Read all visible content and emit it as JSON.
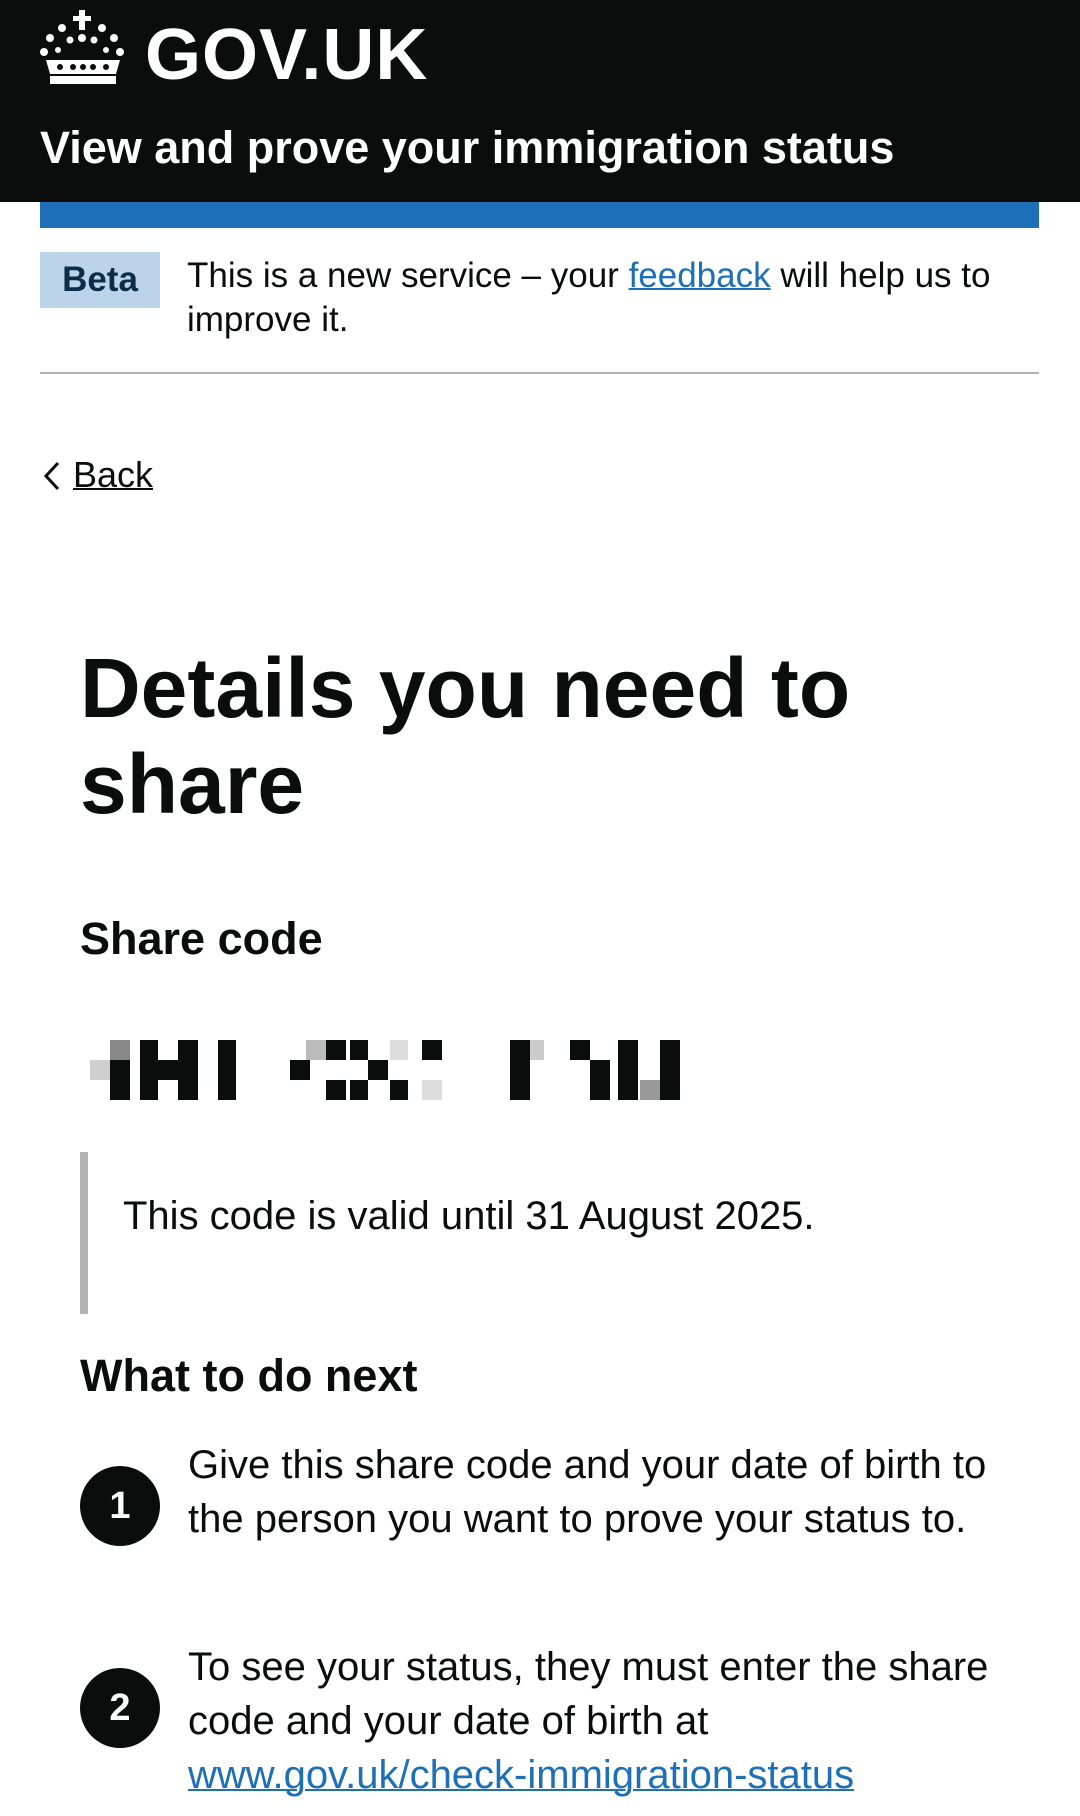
{
  "header": {
    "logo_text": "GOV.UK",
    "service_name": "View and prove your immigration status"
  },
  "phase_banner": {
    "tag": "Beta",
    "text_before": "This is a new service – your ",
    "link_text": "feedback",
    "text_after": " will help us to improve it."
  },
  "back_link": {
    "label": "Back"
  },
  "main": {
    "title": "Details you need to share",
    "share_code_heading": "Share code",
    "share_code_value_obscured": true,
    "inset_text": "This code is valid until 31 August 2025.",
    "next_heading": "What to do next",
    "steps": [
      {
        "number": "1",
        "text": "Give this share code and your date of birth to the person you want to prove your status to."
      },
      {
        "number": "2",
        "text_before": "To see your status, they must enter the share code and your date of birth at ",
        "link_text": "www.gov.uk/check-immigration-status"
      }
    ]
  },
  "colors": {
    "header_bg": "#0b0c0c",
    "brand_blue": "#1d70b8",
    "beta_tag_bg": "#bbd4ea",
    "border_grey": "#b1b4b6"
  }
}
